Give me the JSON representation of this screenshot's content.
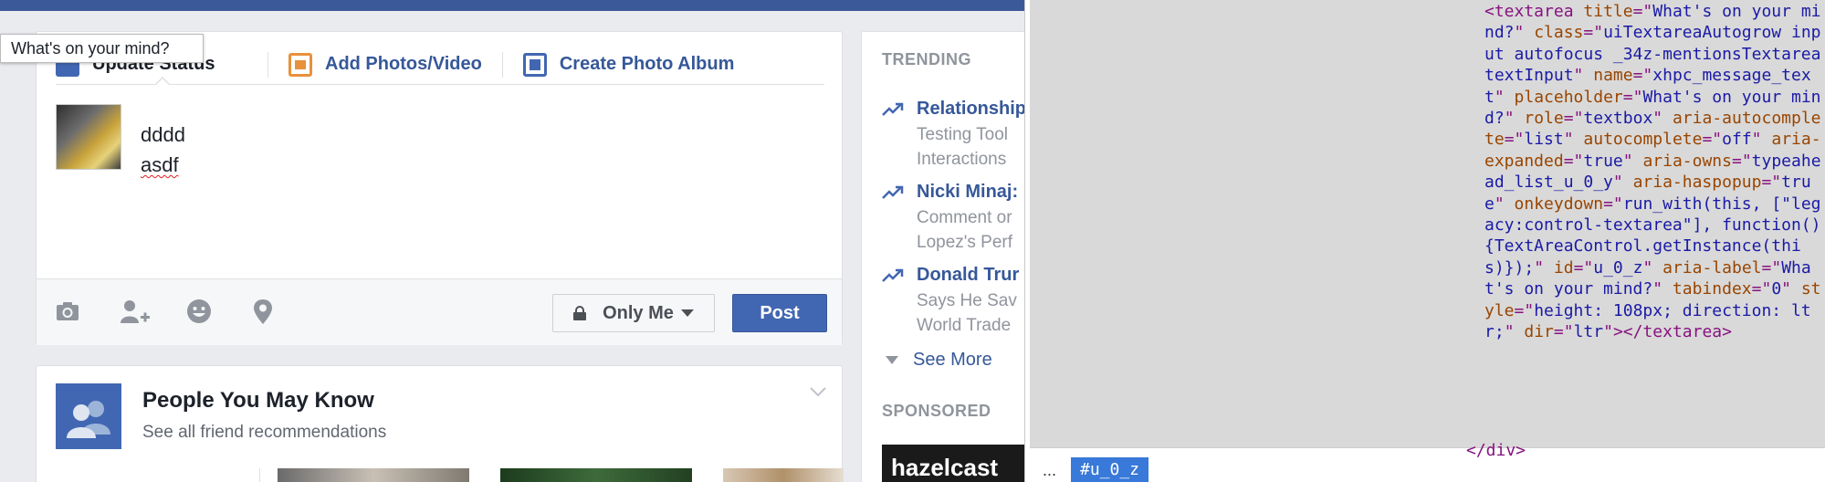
{
  "tooltip": {
    "text": "What's on your mind?"
  },
  "composer": {
    "tabs": [
      {
        "label": "Update Status"
      },
      {
        "label": "Add Photos/Video"
      },
      {
        "label": "Create Photo Album"
      }
    ],
    "status_lines": [
      "dddd",
      "asdf"
    ],
    "audience_label": "Only Me",
    "post_label": "Post",
    "footer_icons": [
      "camera-icon",
      "tag-friends-icon",
      "emoji-icon",
      "location-pin-icon"
    ]
  },
  "pymk": {
    "title": "People You May Know",
    "link": "See all friend recommendations"
  },
  "trending": {
    "header": "TRENDING",
    "items": [
      {
        "title": "Relationship",
        "sub1": "Testing Tool",
        "sub2": "Interactions"
      },
      {
        "title": "Nicki Minaj:",
        "sub1": "Comment or",
        "sub2": "Lopez's Perf"
      },
      {
        "title": "Donald Trur",
        "sub1": "Says He Sav",
        "sub2": "World Trade"
      }
    ],
    "see_more": "See More",
    "sponsored": "SPONSORED",
    "ad_text": "hazelcast"
  },
  "devtools": {
    "tag_open": "<textarea",
    "attrs": [
      {
        "name": "title",
        "value": "What's on your mind?"
      },
      {
        "name": "class",
        "value": "uiTextareaAutogrow input autofocus _34z-mentionsTextarea textInput"
      },
      {
        "name": "name",
        "value": "xhpc_message_text"
      },
      {
        "name": "placeholder",
        "value": "What's on your mind?"
      },
      {
        "name": "role",
        "value": "textbox"
      },
      {
        "name": "aria-autocomplete",
        "value": "list"
      },
      {
        "name": "autocomplete",
        "value": "off"
      },
      {
        "name": "aria-expanded",
        "value": "true"
      },
      {
        "name": "aria-owns",
        "value": "typeahead_list_u_0_y"
      },
      {
        "name": "aria-haspopup",
        "value": "true"
      },
      {
        "name": "onkeydown",
        "value": "run_with(this, [\"legacy:control-textarea\"], function() {TextAreaControl.getInstance(this)});"
      },
      {
        "name": "id",
        "value": "u_0_z"
      },
      {
        "name": "aria-label",
        "value": "What's on your mind?"
      },
      {
        "name": "tabindex",
        "value": "0"
      },
      {
        "name": "style",
        "value": "height: 108px; direction: ltr;"
      },
      {
        "name": "dir",
        "value": "ltr"
      }
    ],
    "tag_close": "></textarea>",
    "next_line": "</div>",
    "breadcrumb_ellipsis": "...",
    "breadcrumb_selected": "#u_0_z"
  },
  "colors": {
    "facebook_blue": "#3b5998",
    "link_blue": "#365899",
    "button_blue": "#4267b2",
    "devtools_selection": "#3879d9"
  }
}
